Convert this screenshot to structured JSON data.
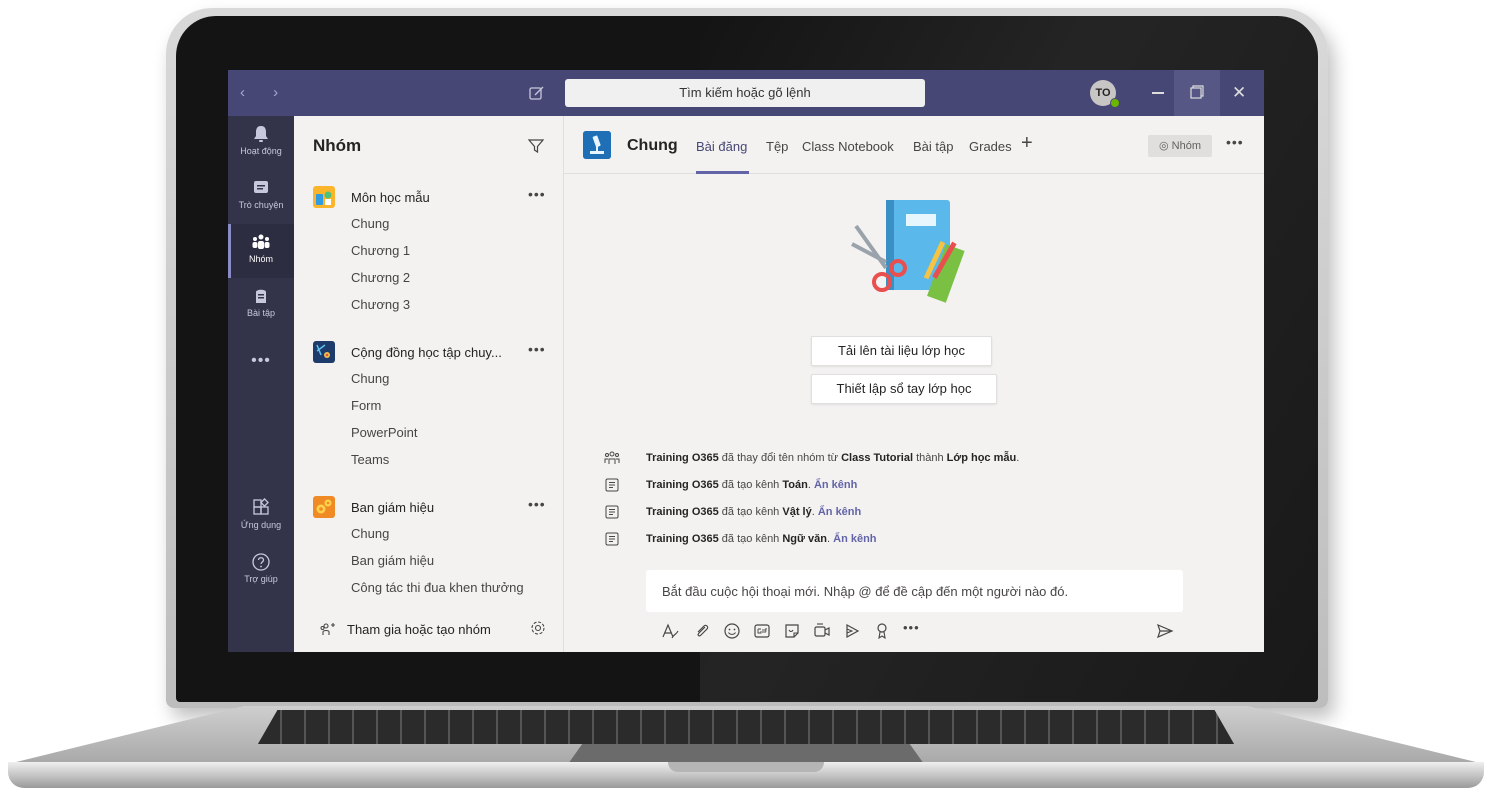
{
  "titlebar": {
    "nav_arrows": "‹ ›",
    "search_placeholder": "Tìm kiếm hoặc gõ lệnh",
    "avatar_initials": "TO",
    "close_glyph": "✕"
  },
  "rail": {
    "items": [
      {
        "label": "Hoạt động",
        "icon": "bell-icon"
      },
      {
        "label": "Trò chuyện",
        "icon": "chat-icon"
      },
      {
        "label": "Nhóm",
        "icon": "teams-icon",
        "active": true
      },
      {
        "label": "Bài tập",
        "icon": "assignments-icon"
      },
      {
        "label": "Ứng dụng",
        "icon": "apps-icon"
      },
      {
        "label": "Trợ giúp",
        "icon": "help-icon"
      }
    ],
    "more": "•••"
  },
  "panel": {
    "title": "Nhóm",
    "teams": [
      {
        "name": "Môn học mẫu",
        "channels": [
          "Chung",
          "Chương 1",
          "Chương 2",
          "Chương 3"
        ]
      },
      {
        "name": "Cộng đồng học tập chuy...",
        "channels": [
          "Chung",
          "Form",
          "PowerPoint",
          "Teams"
        ]
      },
      {
        "name": "Ban giám hiệu",
        "channels": [
          "Chung",
          "Ban giám hiệu",
          "Công tác thi đua khen thưởng"
        ]
      }
    ],
    "more": "•••",
    "footer_label": "Tham gia hoặc tạo nhóm"
  },
  "main": {
    "channel_title": "Chung",
    "tabs": [
      "Bài đăng",
      "Tệp",
      "Class Notebook",
      "Bài tập",
      "Grades"
    ],
    "tab_add": "+",
    "team_badge": "◎ Nhóm",
    "more": "•••",
    "buttons": {
      "upload": "Tải lên tài liệu lớp học",
      "notebook": "Thiết lập sổ tay lớp học"
    },
    "activity": [
      {
        "actor": "Training O365",
        "text1": " đã thay đổi tên nhóm từ ",
        "bold1": "Class Tutorial",
        "text2": " thành ",
        "bold2": "Lớp học mẫu",
        "text3": ".",
        "link": ""
      },
      {
        "actor": "Training O365",
        "text1": " đã tạo kênh ",
        "bold1": "Toán",
        "text2": ". ",
        "bold2": "",
        "text3": "",
        "link": "Ẩn kênh"
      },
      {
        "actor": "Training O365",
        "text1": " đã tạo kênh ",
        "bold1": "Vật lý",
        "text2": ". ",
        "bold2": "",
        "text3": "",
        "link": "Ẩn kênh"
      },
      {
        "actor": "Training O365",
        "text1": " đã tạo kênh ",
        "bold1": "Ngữ văn",
        "text2": ". ",
        "bold2": "",
        "text3": "",
        "link": "Ẩn kênh"
      }
    ],
    "composer_placeholder": "Bắt đầu cuộc hội thoại mới. Nhập @ để đề cập đến một người nào đó.",
    "toolbar_more": "•••"
  },
  "colors": {
    "titlebar": "#464775",
    "rail": "#33344a",
    "accent": "#6264a7",
    "presence": "#6bb700"
  }
}
